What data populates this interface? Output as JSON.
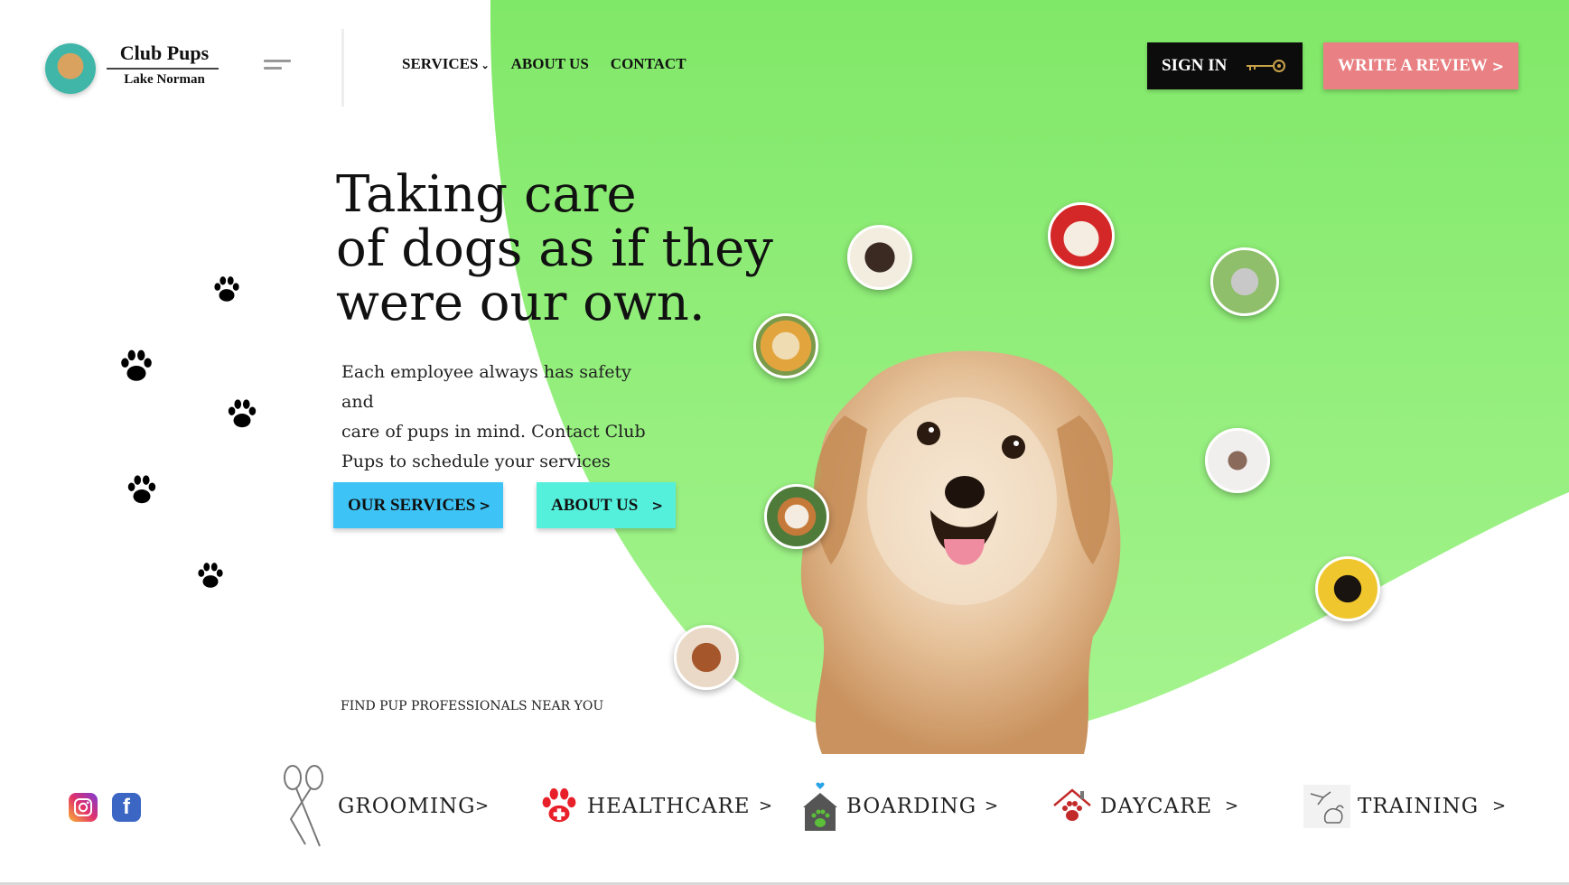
{
  "brand": {
    "name": "Club Pups",
    "location": "Lake Norman"
  },
  "nav": {
    "services": "SERVICES",
    "services_caret": "⌄",
    "about": "ABOUT US",
    "contact": "CONTACT"
  },
  "header_buttons": {
    "sign_in": "SIGN IN",
    "write_review": "WRITE A REVIEW",
    "review_arrow": ">"
  },
  "hero": {
    "title_lines": [
      "Taking care",
      "of dogs as if they",
      "were our own."
    ],
    "description_lines": [
      "Each employee always has safety and",
      "care of pups in mind. Contact Club",
      "Pups to schedule your services today!"
    ],
    "primary_button": "OUR SERVICES",
    "secondary_button": "ABOUT US",
    "button_arrow": ">"
  },
  "find_text": "FIND PUP PROFESSIONALS NEAR YOU",
  "services": [
    {
      "label": "GROOMING",
      "icon": "scissors-icon",
      "arrow": ">"
    },
    {
      "label": "HEALTHCARE",
      "icon": "red-paw-icon",
      "arrow": ">"
    },
    {
      "label": "BOARDING",
      "icon": "dog-house-icon",
      "arrow": ">"
    },
    {
      "label": "DAYCARE",
      "icon": "house-paw-icon",
      "arrow": ">"
    },
    {
      "label": "TRAINING",
      "icon": "dog-training-icon",
      "arrow": ">"
    }
  ],
  "social": {
    "instagram": "instagram-icon",
    "facebook": "f"
  },
  "colors": {
    "accent_green": "#8ee87a",
    "sign_in_bg": "#0c0c0c",
    "review_bg": "#e98083",
    "services_btn_bg": "#3dc3f5",
    "about_btn_bg": "#55f0dc",
    "key_gold": "#c9a24a"
  }
}
